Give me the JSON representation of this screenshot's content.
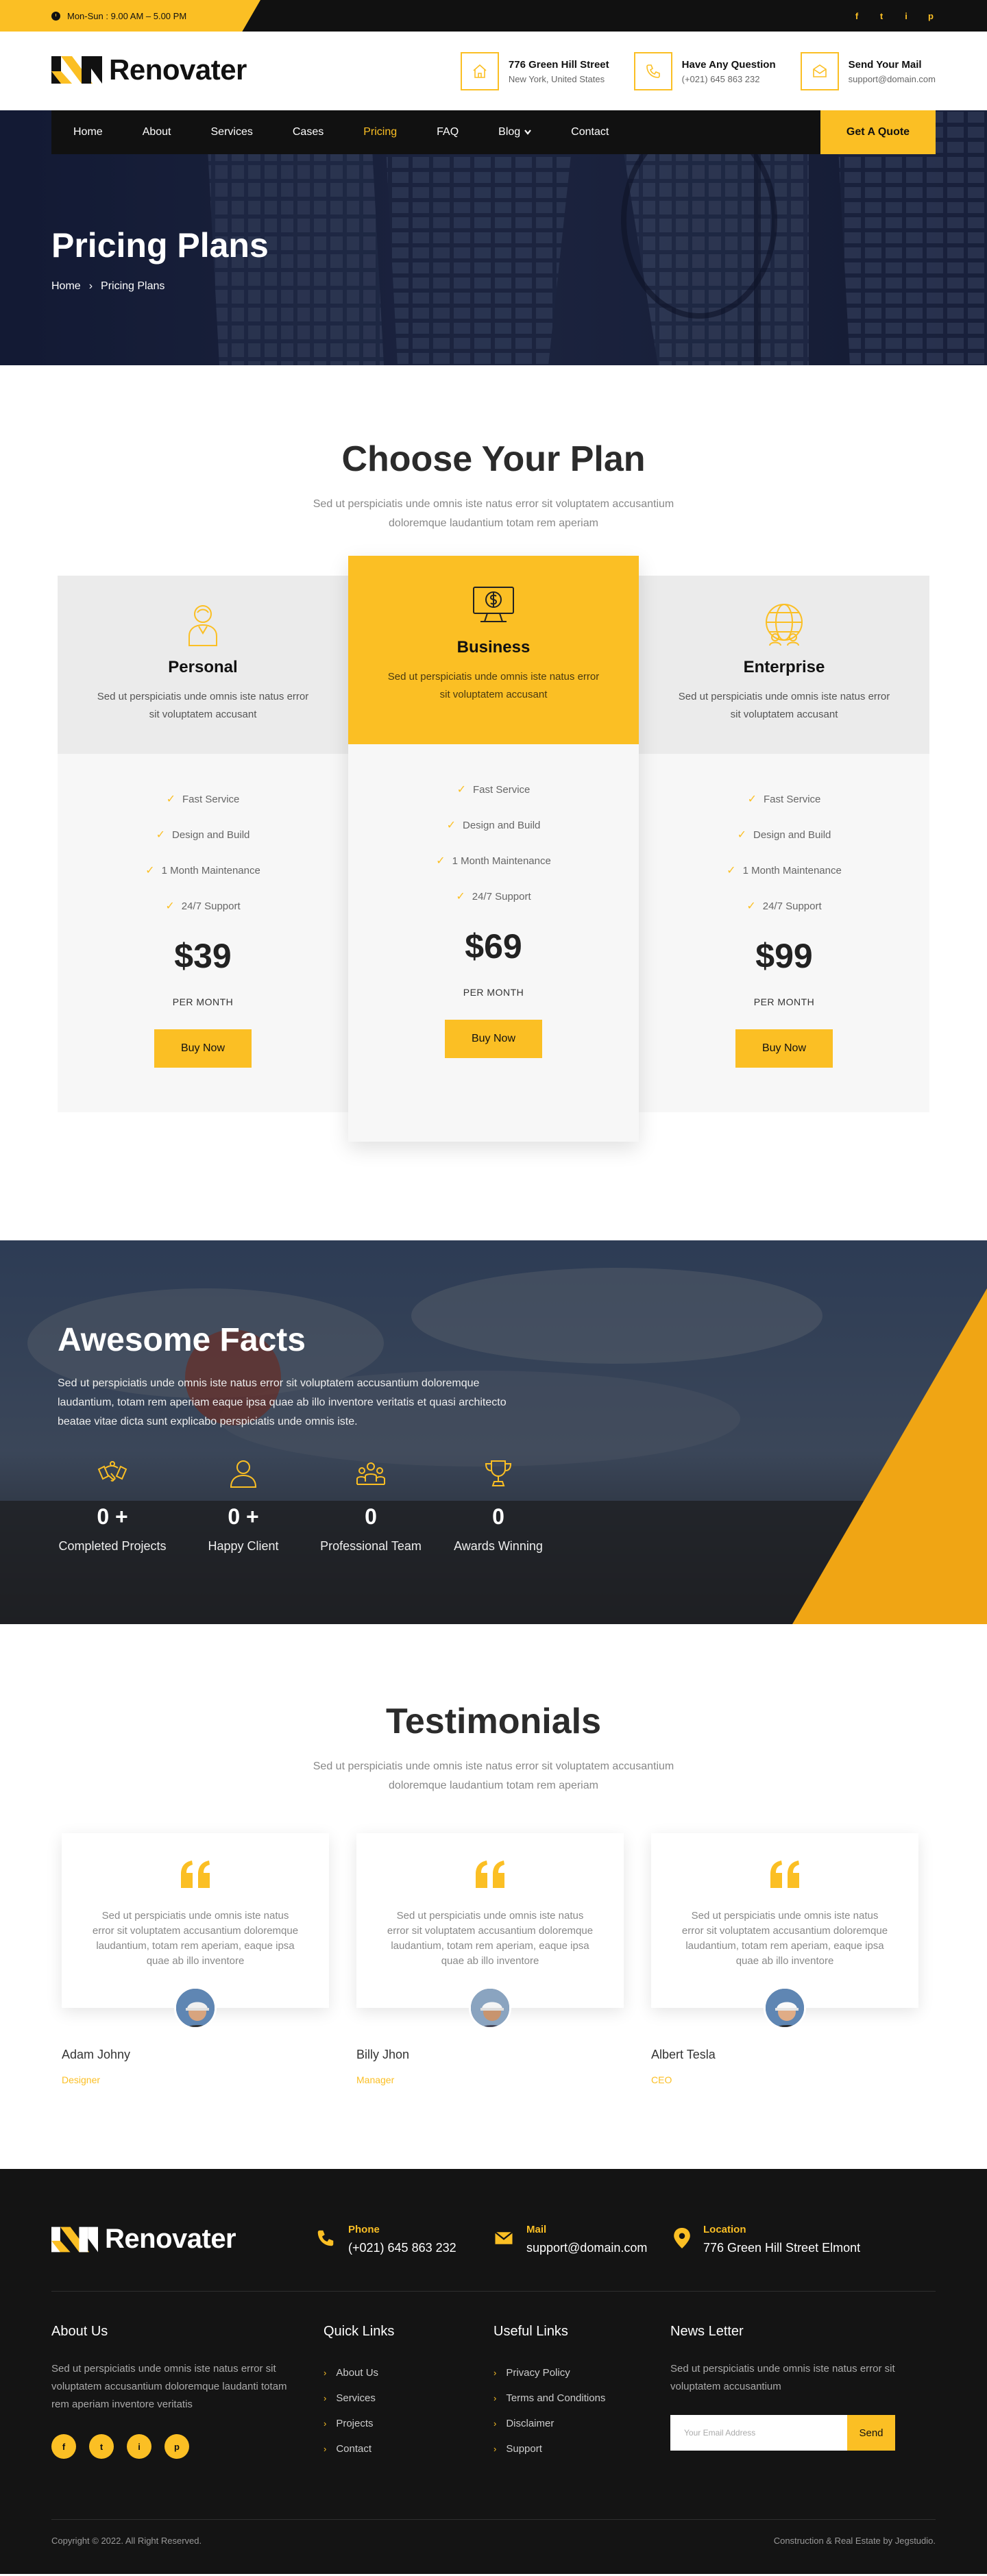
{
  "topbar": {
    "hours": "Mon-Sun : 9.00 AM – 5.00 PM",
    "social": [
      "f",
      "t",
      "i",
      "p"
    ]
  },
  "brand": {
    "name": "Renovater",
    "color": "#fbbf24"
  },
  "header": {
    "contacts": [
      {
        "title": "776 Green Hill Street",
        "sub": "New York, United States",
        "icon": "home-icon"
      },
      {
        "title": "Have Any Question",
        "sub": "(+021) 645 863 232",
        "icon": "phone-icon"
      },
      {
        "title": "Send Your Mail",
        "sub": "support@domain.com",
        "icon": "mail-icon"
      }
    ]
  },
  "nav": {
    "items": [
      "Home",
      "About",
      "Services",
      "Cases",
      "Pricing",
      "FAQ",
      "Blog",
      "Contact"
    ],
    "active": "Pricing",
    "cta": "Get A Quote"
  },
  "hero": {
    "title": "Pricing Plans",
    "crumb_home": "Home",
    "crumb_sep": "›",
    "crumb_current": "Pricing Plans"
  },
  "pricing": {
    "title": "Choose Your Plan",
    "subtitle": "Sed ut perspiciatis unde omnis iste natus error sit voluptatem accusantium doloremque laudantium totam rem aperiam",
    "plans": [
      {
        "name": "Personal",
        "icon": "user-icon",
        "desc": "Sed ut perspiciatis unde omnis iste natus error sit voluptatem accusant",
        "features": [
          "Fast Service",
          "Design and Build",
          "1 Month Maintenance",
          "24/7 Support"
        ],
        "price": "$39",
        "period": "PER MONTH",
        "button": "Buy Now"
      },
      {
        "name": "Business",
        "icon": "monitor-dollar-icon",
        "desc": "Sed ut perspiciatis unde omnis iste natus error sit voluptatem accusant",
        "features": [
          "Fast Service",
          "Design and Build",
          "1 Month Maintenance",
          "24/7 Support"
        ],
        "price": "$69",
        "period": "PER MONTH",
        "button": "Buy Now"
      },
      {
        "name": "Enterprise",
        "icon": "globe-people-icon",
        "desc": "Sed ut perspiciatis unde omnis iste natus error sit voluptatem accusant",
        "features": [
          "Fast Service",
          "Design and Build",
          "1 Month Maintenance",
          "24/7 Support"
        ],
        "price": "$99",
        "period": "PER MONTH",
        "button": "Buy Now"
      }
    ]
  },
  "facts": {
    "title": "Awesome Facts",
    "desc": "Sed ut perspiciatis unde omnis iste natus error sit voluptatem accusantium doloremque laudantium, totam rem aperiam eaque ipsa quae ab illo inventore veritatis et quasi architecto beatae vitae dicta sunt explicabo perspiciatis unde omnis iste.",
    "counters": [
      {
        "num": "0 +",
        "label": "Completed Projects",
        "icon": "handshake-icon"
      },
      {
        "num": "0 +",
        "label": "Happy Client",
        "icon": "user-icon"
      },
      {
        "num": "0",
        "label": "Professional Team",
        "icon": "team-icon"
      },
      {
        "num": "0",
        "label": "Awards Winning",
        "icon": "trophy-icon"
      }
    ]
  },
  "testimonials": {
    "title": "Testimonials",
    "subtitle": "Sed ut perspiciatis unde omnis iste natus error sit voluptatem accusantium doloremque laudantium totam rem aperiam",
    "items": [
      {
        "text": "Sed ut perspiciatis unde omnis iste natus error sit voluptatem accusantium doloremque laudantium, totam rem aperiam, eaque ipsa quae ab illo inventore",
        "name": "Adam Johny",
        "role": "Designer"
      },
      {
        "text": "Sed ut perspiciatis unde omnis iste natus error sit voluptatem accusantium doloremque laudantium, totam rem aperiam, eaque ipsa quae ab illo inventore",
        "name": "Billy Jhon",
        "role": "Manager"
      },
      {
        "text": "Sed ut perspiciatis unde omnis iste natus error sit voluptatem accusantium doloremque laudantium, totam rem aperiam, eaque ipsa quae ab illo inventore",
        "name": "Albert Tesla",
        "role": "CEO"
      }
    ]
  },
  "footer": {
    "phone_label": "Phone",
    "phone": "(+021) 645 863 232",
    "mail_label": "Mail",
    "mail": "support@domain.com",
    "location_label": "Location",
    "location": "776 Green Hill Street Elmont",
    "about_title": "About Us",
    "about_text": "Sed ut perspiciatis unde omnis iste natus error sit voluptatem accusantium doloremque laudanti totam rem aperiam inventore veritatis",
    "social": [
      "f",
      "t",
      "i",
      "p"
    ],
    "quick_title": "Quick Links",
    "quick_links": [
      "About Us",
      "Services",
      "Projects",
      "Contact"
    ],
    "useful_title": "Useful Links",
    "useful_links": [
      "Privacy Policy",
      "Terms and Conditions",
      "Disclaimer",
      "Support"
    ],
    "news_title": "News Letter",
    "news_text": "Sed ut perspiciatis unde omnis iste natus error sit voluptatem accusantium",
    "email_placeholder": "Your Email Address",
    "send": "Send",
    "copyright": "Copyright © 2022. All Right Reserved.",
    "credit": "Construction & Real Estate by Jegstudio."
  }
}
